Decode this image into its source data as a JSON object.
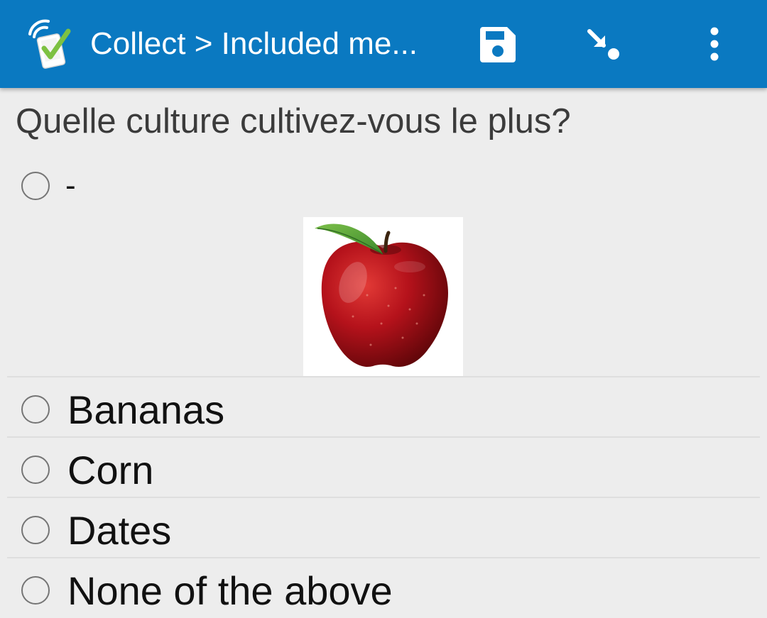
{
  "appbar": {
    "title": "Collect > Included me...",
    "app_icon": "collect-app-logo",
    "save_icon": "save-icon",
    "jump_icon": "jump-to-question-icon",
    "menu_icon": "overflow-menu-icon",
    "background_color": "#0a79c1"
  },
  "question": {
    "label": "Quelle culture cultivez-vous le plus?"
  },
  "options": [
    {
      "label": "-",
      "image": "apple-image",
      "selected": false
    },
    {
      "label": "Bananas",
      "selected": false
    },
    {
      "label": "Corn",
      "selected": false
    },
    {
      "label": "Dates",
      "selected": false
    },
    {
      "label": "None of the above",
      "selected": false
    }
  ]
}
